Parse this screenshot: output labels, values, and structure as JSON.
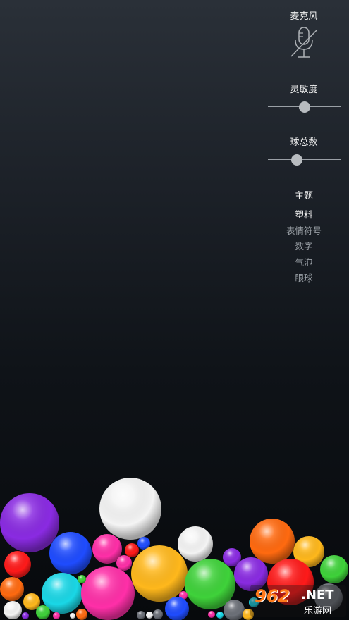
{
  "panel": {
    "microphone_label": "麦克风",
    "microphone_state": "muted",
    "sensitivity_label": "灵敏度",
    "sensitivity_value": 0.5,
    "ball_count_label": "球总数",
    "ball_count_value": 0.4,
    "theme_label": "主题",
    "themes": [
      {
        "label": "塑料",
        "selected": true
      },
      {
        "label": "表情符号",
        "selected": false
      },
      {
        "label": "数字",
        "selected": false
      },
      {
        "label": "气泡",
        "selected": false
      },
      {
        "label": "眼球",
        "selected": false
      }
    ]
  },
  "icons": {
    "microphone": "microphone-muted-icon"
  },
  "colors": {
    "purple": "#8a2be2",
    "white": "#f4f4f4",
    "blue": "#1f4cff",
    "magenta": "#ff2fa8",
    "red": "#ff1a1a",
    "orange": "#ff6a10",
    "yellow": "#ffb81c",
    "green": "#3fd23a",
    "cyan": "#1ad7e6",
    "gray": "#6c7078"
  },
  "watermark": {
    "logo": "962",
    "suffix": ".NET",
    "subtitle": "乐游网"
  }
}
